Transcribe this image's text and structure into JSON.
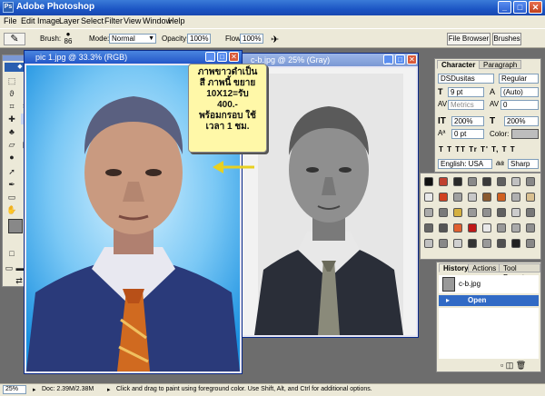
{
  "app": {
    "title": "Adobe Photoshop"
  },
  "menu": [
    "File",
    "Edit",
    "Image",
    "Layer",
    "Select",
    "Filter",
    "View",
    "Window",
    "Help"
  ],
  "options": {
    "brush_label": "Brush:",
    "brush_size": "86",
    "mode_label": "Mode:",
    "mode_value": "Normal",
    "opacity_label": "Opacity:",
    "opacity_value": "100%",
    "flow_label": "Flow:",
    "flow_value": "100%",
    "file_browser": "File Browser",
    "brushes": "Brushes"
  },
  "doc1": {
    "title": "pic 1.jpg @ 33.3% (RGB)"
  },
  "doc2": {
    "title": "c-b.jpg @ 25% (Gray)"
  },
  "callout": {
    "lines": [
      "ภาพขาวดำเป็น",
      "สี ภาพนี้ ขยาย",
      "10X12=รับ",
      "400.-",
      "พร้อมกรอบ ใช้",
      "เวลา 1 ชม."
    ]
  },
  "character": {
    "tab1": "Character",
    "tab2": "Paragraph",
    "font": "DSDusitas",
    "style": "Regular",
    "size": "9 pt",
    "leading": "(Auto)",
    "kerning": "Metrics",
    "tracking": "0",
    "vscale": "200%",
    "hscale": "200%",
    "baseline": "0 pt",
    "color_label": "Color:",
    "language": "English: USA",
    "aa_symbol": "aa",
    "antialias": "Sharp",
    "type_styles": [
      "T",
      "T",
      "TT",
      "Tr",
      "T'",
      "T,",
      "T",
      "T"
    ]
  },
  "styles_colors": [
    "#111111",
    "#c04030",
    "#2a2a2a",
    "#8a8a8a",
    "#3a3a3a",
    "#606060",
    "#c0c0c0",
    "#888888",
    "#e8e8e8",
    "#d04020",
    "#a0a0a0",
    "#c8c8c8",
    "#8a5a30",
    "#d06020",
    "#b0b0b0",
    "#d9c090",
    "#aaaaaa",
    "#7a7a7a",
    "#d4b040",
    "#999999",
    "#909090",
    "#606060",
    "#cccccc",
    "#777777",
    "#666666",
    "#555555",
    "#e06030",
    "#c01818",
    "#e8e8e8",
    "#999999",
    "#aaaaaa",
    "#909090",
    "#c0c0c0",
    "#888888",
    "#cfcfcf",
    "#333333",
    "#999999",
    "#505050",
    "#222222",
    "#888888"
  ],
  "history": {
    "tab1": "History",
    "tab2": "Actions",
    "tab3": "Tool Presets",
    "snapshot": "c-b.jpg",
    "step": "Open"
  },
  "status": {
    "zoom": "25%",
    "doc": "Doc: 2.39M/2.38M",
    "hint": "Click and drag to paint using foreground color.  Use Shift, Alt, and Ctrl for additional options."
  }
}
